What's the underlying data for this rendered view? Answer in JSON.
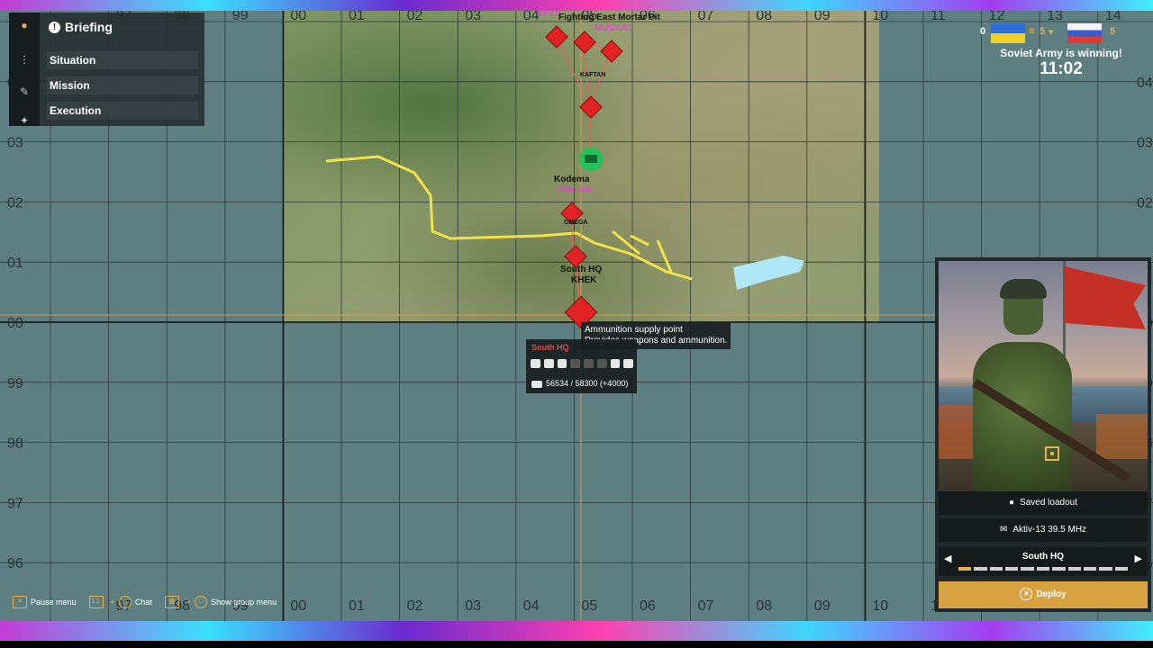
{
  "map": {
    "col_labels": [
      "97",
      "98",
      "99",
      "00",
      "01",
      "02",
      "03",
      "04",
      "05",
      "06",
      "07",
      "08",
      "09",
      "10",
      "11",
      "12",
      "13",
      "14"
    ],
    "row_labels": [
      "04",
      "03",
      "02",
      "01",
      "00",
      "99",
      "98",
      "97",
      "96"
    ],
    "locations": {
      "kodema": "Kodema",
      "yantar": "YANTAR",
      "south_hq": "South HQ",
      "khek": "KHEK",
      "muskat": "MUSKAT",
      "veza": "VEZA",
      "top_label": "Fighting East Mortar Pit",
      "kaftan": "KAFTAN",
      "omega": "OMEGA"
    }
  },
  "briefing": {
    "title": "Briefing",
    "items": [
      "Situation",
      "Mission",
      "Execution"
    ]
  },
  "score": {
    "left": "0",
    "mid_left": "5",
    "right": "5",
    "message": "Soviet Army is winning!",
    "time": "11:02"
  },
  "tooltip": {
    "title": "Ammunition supply point",
    "desc": "Provides weapons and ammunition."
  },
  "hq_panel": {
    "name": "South HQ",
    "supplies": "56534 / 58300 (+4000)"
  },
  "deploy": {
    "loadout": "Saved loadout",
    "radio": "Aktiv-13 39.5 MHz",
    "spawn": "South HQ",
    "button": "Deploy"
  },
  "hints": {
    "pause": "Pause menu",
    "chat": "Chat",
    "group": "Show group menu"
  },
  "colors": {
    "map_bg": "#5d7f82",
    "accent": "#e8b04a",
    "enemy": "#e32323",
    "friendly": "#1fc45a",
    "road": "#f2e14a",
    "water": "#aee8f8"
  }
}
